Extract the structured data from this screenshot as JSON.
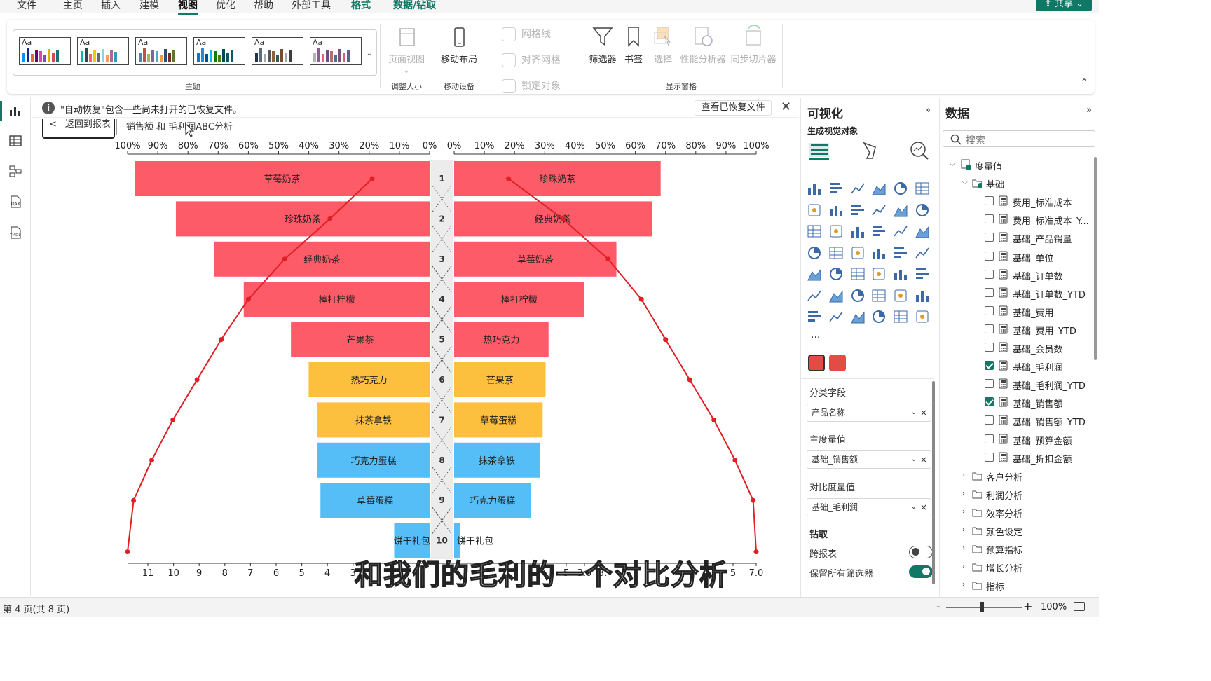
{
  "menu": {
    "items": [
      "文件",
      "主页",
      "插入",
      "建模",
      "视图",
      "优化",
      "帮助",
      "外部工具",
      "格式",
      "数据/钻取"
    ],
    "active": "视图",
    "share_label": "共享"
  },
  "ribbon": {
    "themes_group_label": "主题",
    "theme_swatch_text": "Aa",
    "page_view_label": "页面视图",
    "adjust_size_label": "调整大小",
    "mobile_layout_label": "移动布局",
    "mobile_device_label": "移动设备",
    "gridlines_label": "网格线",
    "snap_grid_label": "对齐网格",
    "lock_objects_label": "锁定对象",
    "filters_label": "筛选器",
    "bookmarks_label": "书签",
    "selection_label": "选择",
    "perf_analyzer_label": "性能分析器",
    "sync_slicers_label": "同步切片器",
    "show_panes_label": "显示窗格"
  },
  "infobar": {
    "message": "\"自动恢复\"包含一些尚未打开的已恢复文件。",
    "button_label": "查看已恢复文件"
  },
  "canvas": {
    "back_button_label": "返回到报表",
    "tab_title": "销售额 和 毛利润ABC分析",
    "subtitle": "和我们的毛利的一个对比分析"
  },
  "chart_data": {
    "type": "bar",
    "left_top_axis_ticks": [
      "100%",
      "90%",
      "80%",
      "70%",
      "60%",
      "50%",
      "40%",
      "30%",
      "20%",
      "10%",
      "0%"
    ],
    "right_top_axis_ticks": [
      "0%",
      "10%",
      "20%",
      "30%",
      "40%",
      "50%",
      "60%",
      "70%",
      "80%",
      "90%",
      "100%"
    ],
    "left_bottom_axis_ticks": [
      "11",
      "10",
      "9",
      "8",
      "7",
      "6",
      "5",
      "4",
      "3"
    ],
    "right_bottom_axis_ticks": [
      "5",
      "3.0",
      "3.",
      "5",
      "7.0"
    ],
    "ranks": [
      1,
      2,
      3,
      4,
      5,
      6,
      7,
      8,
      9,
      10
    ],
    "left_series": {
      "categories": [
        "草莓奶茶",
        "珍珠奶茶",
        "经典奶茶",
        "棒打柠檬",
        "芒果茶",
        "热巧克力",
        "抹茶拿铁",
        "巧克力蛋糕",
        "草莓蛋糕",
        "饼干礼包"
      ],
      "bar_values": [
        10,
        8.6,
        7.3,
        6.3,
        4.7,
        4.1,
        3.8,
        3.8,
        3.7,
        1.2
      ],
      "class": [
        "A",
        "A",
        "A",
        "A",
        "A",
        "B",
        "B",
        "C",
        "C",
        "C"
      ],
      "cumulative_pct": [
        19,
        33,
        48,
        60,
        69,
        77,
        85,
        92,
        98,
        100
      ]
    },
    "right_series": {
      "categories": [
        "珍珠奶茶",
        "经典奶茶",
        "草莓奶茶",
        "棒打柠檬",
        "热巧克力",
        "芒果茶",
        "草莓蛋糕",
        "抹茶拿铁",
        "巧克力蛋糕",
        "饼干礼包"
      ],
      "bar_values": [
        7,
        6.7,
        5.5,
        4.4,
        3.2,
        3.1,
        3.0,
        2.9,
        2.6,
        0.2
      ],
      "class": [
        "A",
        "A",
        "A",
        "A",
        "A",
        "B",
        "B",
        "C",
        "C",
        "C"
      ],
      "cumulative_pct": [
        18,
        36,
        51,
        62,
        70,
        78,
        86,
        93,
        99,
        100
      ]
    },
    "colors": {
      "A": "#fd5b68",
      "B": "#fcc03e",
      "C": "#55bef7",
      "line": "#e01f26"
    }
  },
  "viz_pane": {
    "title": "可视化",
    "build_visual_label": "生成视觉对象",
    "category_field_label": "分类字段",
    "category_field_value": "产品名称",
    "main_measure_label": "主度量值",
    "main_measure_value": "基础_销售额",
    "compare_measure_label": "对比度量值",
    "compare_measure_value": "基础_毛利润",
    "drill_label": "钻取",
    "cross_report_label": "跨报表",
    "keep_filters_label": "保留所有筛选器",
    "more_label": "..."
  },
  "data_pane": {
    "title": "数据",
    "search_placeholder": "搜索",
    "root_label": "度量值",
    "folder_label": "基础",
    "fields": [
      {
        "label": "费用_标准成本",
        "checked": false
      },
      {
        "label": "费用_标准成本_Y...",
        "checked": false
      },
      {
        "label": "基础_产品销量",
        "checked": false
      },
      {
        "label": "基础_单位",
        "checked": false
      },
      {
        "label": "基础_订单数",
        "checked": false
      },
      {
        "label": "基础_订单数_YTD",
        "checked": false
      },
      {
        "label": "基础_费用",
        "checked": false
      },
      {
        "label": "基础_费用_YTD",
        "checked": false
      },
      {
        "label": "基础_会员数",
        "checked": false
      },
      {
        "label": "基础_毛利润",
        "checked": true
      },
      {
        "label": "基础_毛利润_YTD",
        "checked": false
      },
      {
        "label": "基础_销售额",
        "checked": true
      },
      {
        "label": "基础_销售额_YTD",
        "checked": false
      },
      {
        "label": "基础_预算金额",
        "checked": false
      },
      {
        "label": "基础_折扣金额",
        "checked": false
      }
    ],
    "folders": [
      "客户分析",
      "利润分析",
      "效率分析",
      "颜色设定",
      "预算指标",
      "增长分析",
      "指标"
    ]
  },
  "status": {
    "page_indicator": "第 4 页(共 8 页)",
    "zoom": "100%"
  }
}
